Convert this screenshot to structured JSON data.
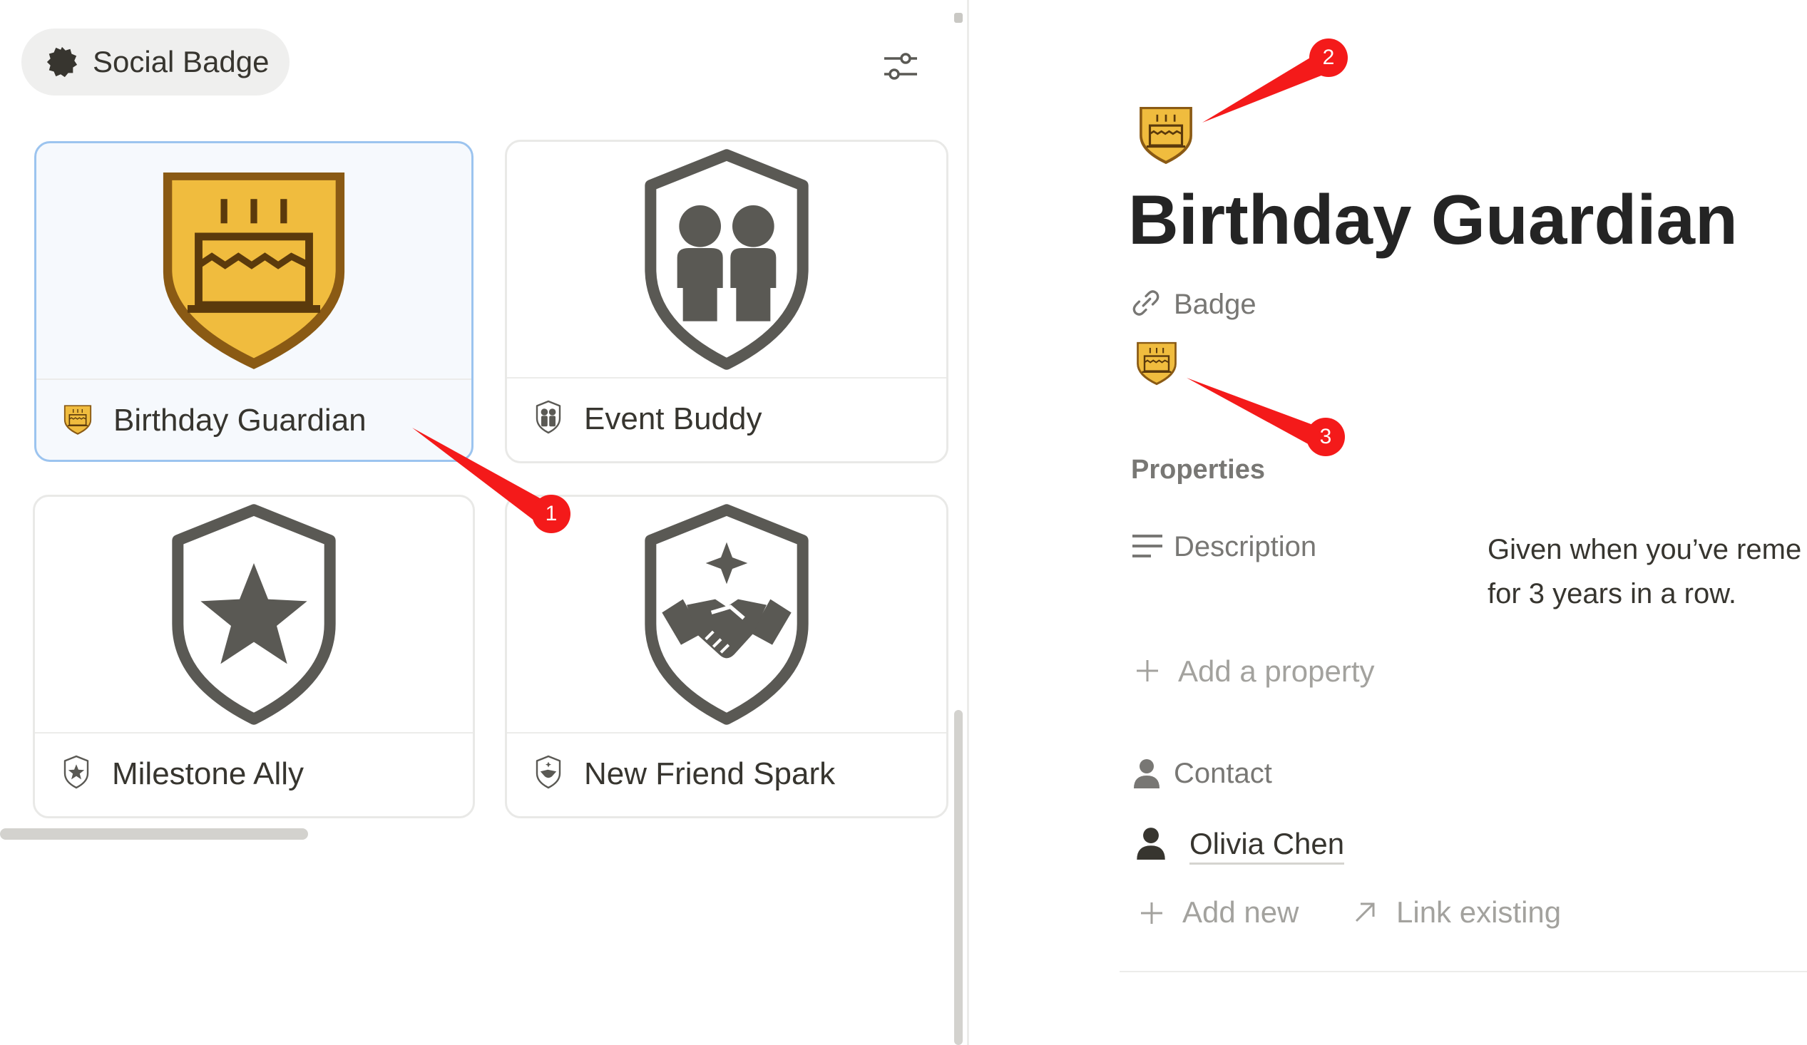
{
  "filter_chip": {
    "label": "Social Badge",
    "icon": "badge-seal-icon"
  },
  "settings": {
    "icon": "sliders-icon"
  },
  "gallery": {
    "cards": [
      {
        "title": "Birthday Guardian",
        "icon": "birthday-cake-shield-icon",
        "selected": true
      },
      {
        "title": "Event Buddy",
        "icon": "people-shield-icon",
        "selected": false
      },
      {
        "title": "Milestone Ally",
        "icon": "star-shield-icon",
        "selected": false
      },
      {
        "title": "New Friend Spark",
        "icon": "handshake-shield-icon",
        "selected": false
      }
    ]
  },
  "page": {
    "title": "Birthday Guardian",
    "badge_label": "Badge",
    "properties_label": "Properties",
    "description_label": "Description",
    "description_value_line1": "Given when you’ve reme",
    "description_value_line2": "for 3 years in a row.",
    "add_property_label": "Add a property",
    "contact_label": "Contact",
    "contact_name": "Olivia Chen",
    "add_new_label": "Add new",
    "link_existing_label": "Link existing"
  },
  "annotations": [
    {
      "number": "1"
    },
    {
      "number": "2"
    },
    {
      "number": "3"
    }
  ],
  "colors": {
    "accent_badge": "#f0bc3e",
    "badge_dark": "#8a5a14",
    "shield_gray": "#5a5954",
    "annotation_red": "#f41a1a",
    "selection_border": "#9cc4ef"
  }
}
